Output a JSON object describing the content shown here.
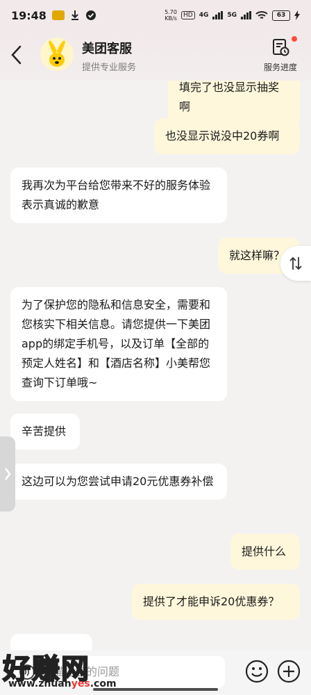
{
  "status_bar": {
    "time": "19:48",
    "net_speed": "5.70",
    "net_unit": "KB/s",
    "hd_badge": "HD",
    "net_4g": "4G",
    "net_5g": "5G",
    "battery": "63"
  },
  "header": {
    "title": "美团客服",
    "subtitle": "提供专业服务",
    "progress_label": "服务进度"
  },
  "messages": [
    {
      "side": "me",
      "text": "填完了也没显示抽奖啊"
    },
    {
      "side": "me",
      "text": "也没显示说没中20券啊"
    },
    {
      "side": "them",
      "text": "我再次为平台给您带来不好的服务体验表示真诚的歉意"
    },
    {
      "side": "me",
      "text": "就这样嘛？"
    },
    {
      "side": "them",
      "text": "为了保护您的隐私和信息安全，需要和您核实下相关信息。请您提供一下美团app的绑定手机号，以及订单【全部的预定人姓名】和【酒店名称】小美帮您查询下订单哦~"
    },
    {
      "side": "them",
      "text": "辛苦提供"
    },
    {
      "side": "them",
      "text": "这边可以为您尝试申请20元优惠券补偿"
    },
    {
      "side": "me",
      "text": "提供什么"
    },
    {
      "side": "me",
      "text": "提供了才能申诉20优惠券？"
    }
  ],
  "input": {
    "placeholder": "请描述您的问题"
  },
  "watermark": {
    "brand": "好赚网",
    "url_pre": "www.zhuan",
    "url_hl": "yes",
    "url_post": ".com"
  },
  "icons": [
    "back-arrow-icon",
    "avatar-logo",
    "service-progress-icon",
    "sort-icon",
    "expand-chevron-icon",
    "microphone-icon",
    "emoji-icon",
    "plus-icon"
  ]
}
